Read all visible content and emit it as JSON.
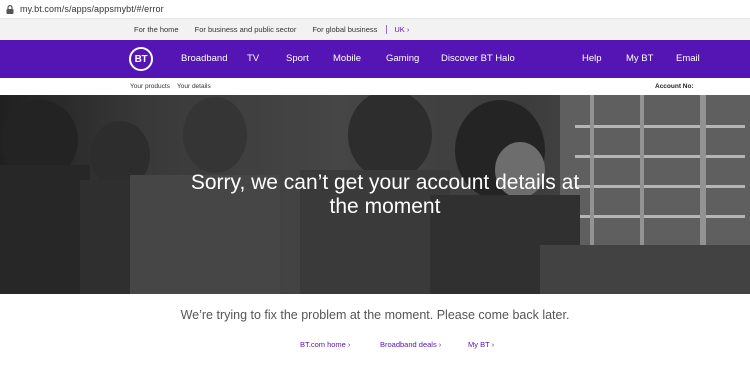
{
  "browser": {
    "url": "my.bt.com/s/apps/appsmybt/#/error"
  },
  "top_strip": {
    "items": [
      "For the home",
      "For business and public sector",
      "For global business"
    ],
    "region": "UK ›"
  },
  "nav": {
    "logo": "BT",
    "items": [
      "Broadband",
      "TV",
      "Sport",
      "Mobile",
      "Gaming",
      "Discover BT Halo"
    ],
    "right_items": [
      "Help",
      "My BT",
      "Email"
    ]
  },
  "sub_bar": {
    "items": [
      "Your products",
      "Your details"
    ],
    "account": "Account No:"
  },
  "hero": {
    "heading": "Sorry, we can’t get your account details at the moment"
  },
  "message": "We’re trying to fix the problem at the moment. Please come back later.",
  "links": [
    "BT.com home ›",
    "Broadband deals ›",
    "My BT ›"
  ],
  "colors": {
    "brand": "#5514b4",
    "strip_bg": "#f2f2f2"
  },
  "icons": {
    "address_bar": "lock-icon"
  }
}
